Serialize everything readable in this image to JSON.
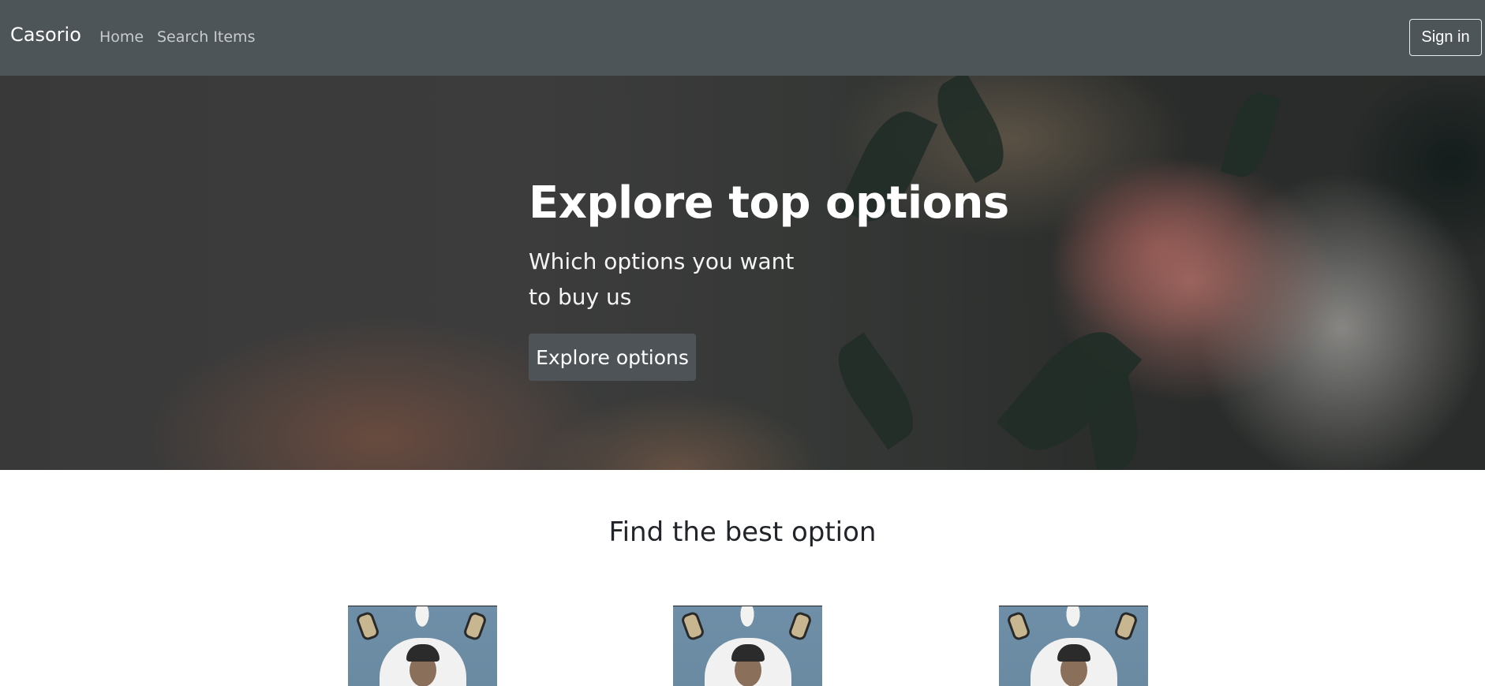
{
  "navbar": {
    "brand": "Casorio",
    "links": [
      {
        "label": "Home"
      },
      {
        "label": "Search Items"
      }
    ],
    "signin_label": "Sign in"
  },
  "hero": {
    "title": "Explore top options",
    "subtitle": "Which options you want to buy us",
    "button_label": "Explore options"
  },
  "section": {
    "title": "Find the best option"
  },
  "colors": {
    "navbar_bg": "#4e5559",
    "hero_button_bg": "#4d5357",
    "section_text": "#212529"
  }
}
